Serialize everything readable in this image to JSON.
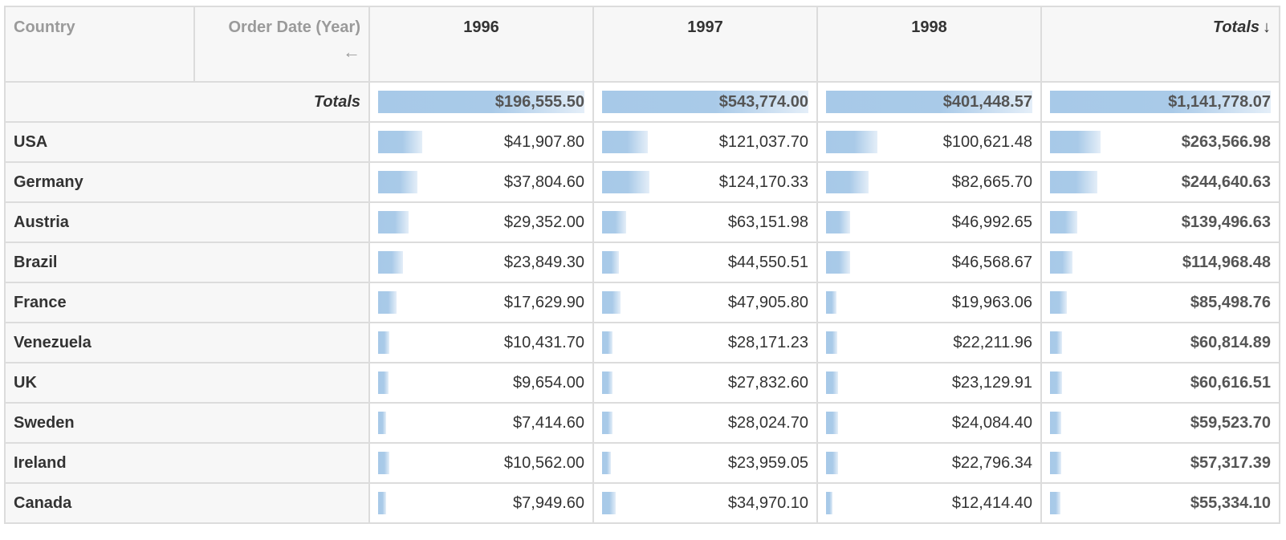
{
  "header": {
    "row_dimension": "Country",
    "col_dimension": "Order Date (Year)",
    "col_dimension_arrow": "←",
    "years": [
      "1996",
      "1997",
      "1998"
    ],
    "totals_label": "Totals",
    "totals_sort_icon": "↓"
  },
  "totals_row": {
    "label": "Totals",
    "values": [
      "$196,555.50",
      "$543,774.00",
      "$401,448.57"
    ],
    "grand_total": "$1,141,778.07"
  },
  "rows": [
    {
      "country": "USA",
      "values": [
        "$41,907.80",
        "$121,037.70",
        "$100,621.48"
      ],
      "total": "$263,566.98"
    },
    {
      "country": "Germany",
      "values": [
        "$37,804.60",
        "$124,170.33",
        "$82,665.70"
      ],
      "total": "$244,640.63"
    },
    {
      "country": "Austria",
      "values": [
        "$29,352.00",
        "$63,151.98",
        "$46,992.65"
      ],
      "total": "$139,496.63"
    },
    {
      "country": "Brazil",
      "values": [
        "$23,849.30",
        "$44,550.51",
        "$46,568.67"
      ],
      "total": "$114,968.48"
    },
    {
      "country": "France",
      "values": [
        "$17,629.90",
        "$47,905.80",
        "$19,963.06"
      ],
      "total": "$85,498.76"
    },
    {
      "country": "Venezuela",
      "values": [
        "$10,431.70",
        "$28,171.23",
        "$22,211.96"
      ],
      "total": "$60,814.89"
    },
    {
      "country": "UK",
      "values": [
        "$9,654.00",
        "$27,832.60",
        "$23,129.91"
      ],
      "total": "$60,616.51"
    },
    {
      "country": "Sweden",
      "values": [
        "$7,414.60",
        "$28,024.70",
        "$24,084.40"
      ],
      "total": "$59,523.70"
    },
    {
      "country": "Ireland",
      "values": [
        "$10,562.00",
        "$23,959.05",
        "$22,796.34"
      ],
      "total": "$57,317.39"
    },
    {
      "country": "Canada",
      "values": [
        "$7,949.60",
        "$34,970.10",
        "$12,414.40"
      ],
      "total": "$55,334.10"
    }
  ],
  "colors": {
    "bar": "#a7c9e8",
    "header_bg": "#f7f7f7",
    "border": "#dcdcdc"
  }
}
